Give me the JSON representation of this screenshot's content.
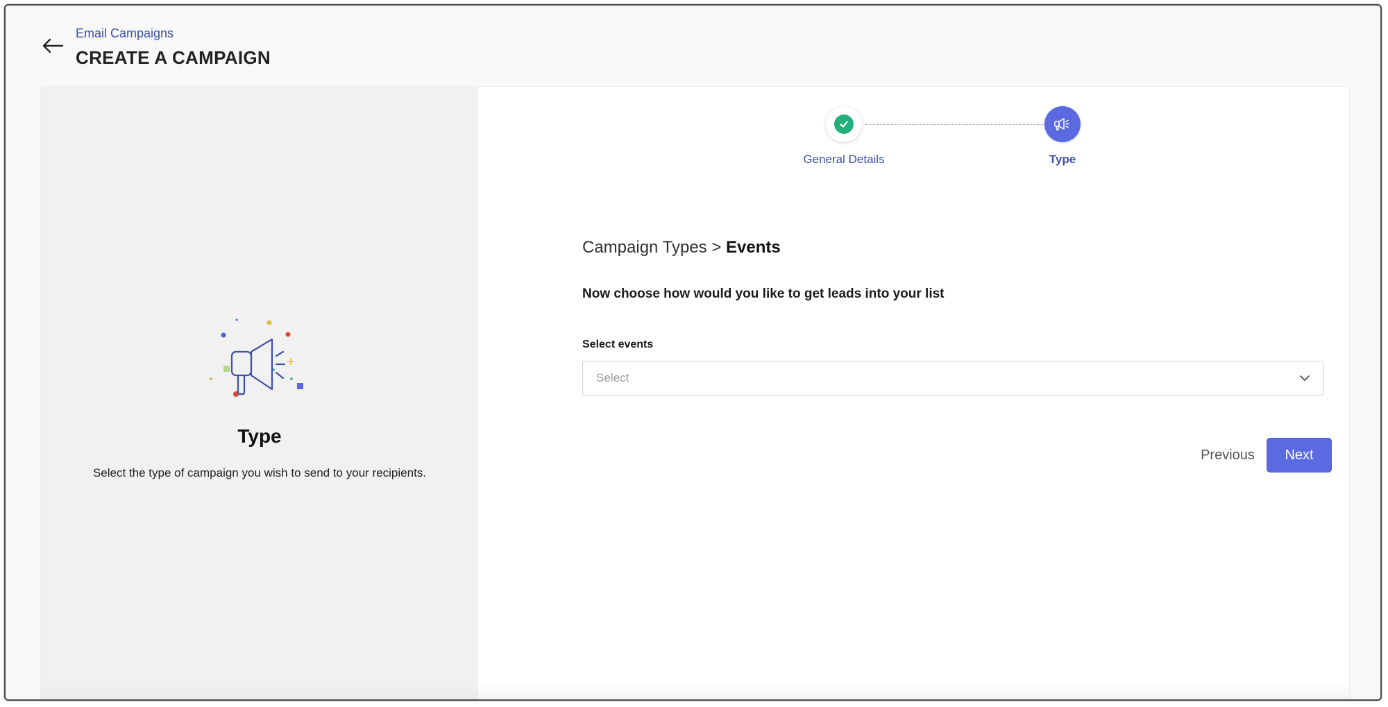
{
  "header": {
    "breadcrumb": "Email Campaigns",
    "title": "CREATE A CAMPAIGN"
  },
  "left_panel": {
    "illustration_icon": "megaphone-icon",
    "title": "Type",
    "description": "Select the type of campaign you wish to send to your recipients."
  },
  "stepper": {
    "steps": [
      {
        "label": "General Details",
        "status": "completed",
        "icon": "check-icon"
      },
      {
        "label": "Type",
        "status": "active",
        "icon": "megaphone-icon"
      }
    ]
  },
  "form": {
    "breadcrumb_parent": "Campaign Types >",
    "breadcrumb_current": "Events",
    "instruction": "Now choose how would you like to get leads into your list",
    "events_label": "Select events",
    "events_placeholder": "Select"
  },
  "actions": {
    "previous_label": "Previous",
    "next_label": "Next"
  },
  "colors": {
    "accent": "#5b6ae0",
    "link": "#3f4fa8",
    "success": "#23b07a",
    "left_panel_bg": "#f1f1f1"
  }
}
